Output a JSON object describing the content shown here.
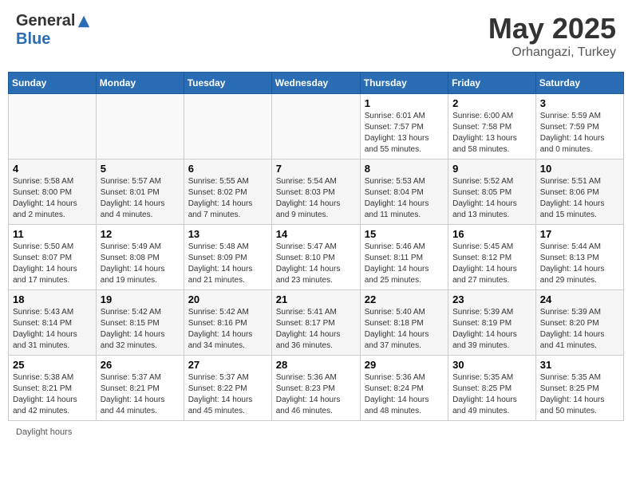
{
  "header": {
    "logo_general": "General",
    "logo_blue": "Blue",
    "month": "May 2025",
    "location": "Orhangazi, Turkey"
  },
  "days_of_week": [
    "Sunday",
    "Monday",
    "Tuesday",
    "Wednesday",
    "Thursday",
    "Friday",
    "Saturday"
  ],
  "weeks": [
    [
      {
        "day": "",
        "info": ""
      },
      {
        "day": "",
        "info": ""
      },
      {
        "day": "",
        "info": ""
      },
      {
        "day": "",
        "info": ""
      },
      {
        "day": "1",
        "info": "Sunrise: 6:01 AM\nSunset: 7:57 PM\nDaylight: 13 hours\nand 55 minutes."
      },
      {
        "day": "2",
        "info": "Sunrise: 6:00 AM\nSunset: 7:58 PM\nDaylight: 13 hours\nand 58 minutes."
      },
      {
        "day": "3",
        "info": "Sunrise: 5:59 AM\nSunset: 7:59 PM\nDaylight: 14 hours\nand 0 minutes."
      }
    ],
    [
      {
        "day": "4",
        "info": "Sunrise: 5:58 AM\nSunset: 8:00 PM\nDaylight: 14 hours\nand 2 minutes."
      },
      {
        "day": "5",
        "info": "Sunrise: 5:57 AM\nSunset: 8:01 PM\nDaylight: 14 hours\nand 4 minutes."
      },
      {
        "day": "6",
        "info": "Sunrise: 5:55 AM\nSunset: 8:02 PM\nDaylight: 14 hours\nand 7 minutes."
      },
      {
        "day": "7",
        "info": "Sunrise: 5:54 AM\nSunset: 8:03 PM\nDaylight: 14 hours\nand 9 minutes."
      },
      {
        "day": "8",
        "info": "Sunrise: 5:53 AM\nSunset: 8:04 PM\nDaylight: 14 hours\nand 11 minutes."
      },
      {
        "day": "9",
        "info": "Sunrise: 5:52 AM\nSunset: 8:05 PM\nDaylight: 14 hours\nand 13 minutes."
      },
      {
        "day": "10",
        "info": "Sunrise: 5:51 AM\nSunset: 8:06 PM\nDaylight: 14 hours\nand 15 minutes."
      }
    ],
    [
      {
        "day": "11",
        "info": "Sunrise: 5:50 AM\nSunset: 8:07 PM\nDaylight: 14 hours\nand 17 minutes."
      },
      {
        "day": "12",
        "info": "Sunrise: 5:49 AM\nSunset: 8:08 PM\nDaylight: 14 hours\nand 19 minutes."
      },
      {
        "day": "13",
        "info": "Sunrise: 5:48 AM\nSunset: 8:09 PM\nDaylight: 14 hours\nand 21 minutes."
      },
      {
        "day": "14",
        "info": "Sunrise: 5:47 AM\nSunset: 8:10 PM\nDaylight: 14 hours\nand 23 minutes."
      },
      {
        "day": "15",
        "info": "Sunrise: 5:46 AM\nSunset: 8:11 PM\nDaylight: 14 hours\nand 25 minutes."
      },
      {
        "day": "16",
        "info": "Sunrise: 5:45 AM\nSunset: 8:12 PM\nDaylight: 14 hours\nand 27 minutes."
      },
      {
        "day": "17",
        "info": "Sunrise: 5:44 AM\nSunset: 8:13 PM\nDaylight: 14 hours\nand 29 minutes."
      }
    ],
    [
      {
        "day": "18",
        "info": "Sunrise: 5:43 AM\nSunset: 8:14 PM\nDaylight: 14 hours\nand 31 minutes."
      },
      {
        "day": "19",
        "info": "Sunrise: 5:42 AM\nSunset: 8:15 PM\nDaylight: 14 hours\nand 32 minutes."
      },
      {
        "day": "20",
        "info": "Sunrise: 5:42 AM\nSunset: 8:16 PM\nDaylight: 14 hours\nand 34 minutes."
      },
      {
        "day": "21",
        "info": "Sunrise: 5:41 AM\nSunset: 8:17 PM\nDaylight: 14 hours\nand 36 minutes."
      },
      {
        "day": "22",
        "info": "Sunrise: 5:40 AM\nSunset: 8:18 PM\nDaylight: 14 hours\nand 37 minutes."
      },
      {
        "day": "23",
        "info": "Sunrise: 5:39 AM\nSunset: 8:19 PM\nDaylight: 14 hours\nand 39 minutes."
      },
      {
        "day": "24",
        "info": "Sunrise: 5:39 AM\nSunset: 8:20 PM\nDaylight: 14 hours\nand 41 minutes."
      }
    ],
    [
      {
        "day": "25",
        "info": "Sunrise: 5:38 AM\nSunset: 8:21 PM\nDaylight: 14 hours\nand 42 minutes."
      },
      {
        "day": "26",
        "info": "Sunrise: 5:37 AM\nSunset: 8:21 PM\nDaylight: 14 hours\nand 44 minutes."
      },
      {
        "day": "27",
        "info": "Sunrise: 5:37 AM\nSunset: 8:22 PM\nDaylight: 14 hours\nand 45 minutes."
      },
      {
        "day": "28",
        "info": "Sunrise: 5:36 AM\nSunset: 8:23 PM\nDaylight: 14 hours\nand 46 minutes."
      },
      {
        "day": "29",
        "info": "Sunrise: 5:36 AM\nSunset: 8:24 PM\nDaylight: 14 hours\nand 48 minutes."
      },
      {
        "day": "30",
        "info": "Sunrise: 5:35 AM\nSunset: 8:25 PM\nDaylight: 14 hours\nand 49 minutes."
      },
      {
        "day": "31",
        "info": "Sunrise: 5:35 AM\nSunset: 8:25 PM\nDaylight: 14 hours\nand 50 minutes."
      }
    ]
  ],
  "footer": {
    "text": "Daylight hours"
  }
}
